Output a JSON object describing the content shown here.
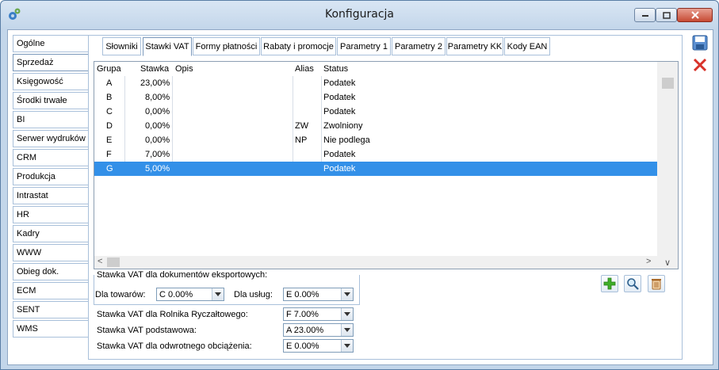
{
  "window": {
    "title": "Konfiguracja"
  },
  "nav": {
    "items": [
      {
        "label": "Ogólne"
      },
      {
        "label": "Sprzedaż"
      },
      {
        "label": "Księgowość"
      },
      {
        "label": "Środki trwałe"
      },
      {
        "label": "BI"
      },
      {
        "label": "Serwer wydruków"
      },
      {
        "label": "CRM"
      },
      {
        "label": "Produkcja"
      },
      {
        "label": "Intrastat"
      },
      {
        "label": "HR"
      },
      {
        "label": "Kadry"
      },
      {
        "label": "WWW"
      },
      {
        "label": "Obieg dok."
      },
      {
        "label": "ECM"
      },
      {
        "label": "SENT"
      },
      {
        "label": "WMS"
      }
    ],
    "active": "Sprzedaż"
  },
  "tabs": [
    {
      "label": "Słowniki"
    },
    {
      "label": "Stawki VAT"
    },
    {
      "label": "Formy płatności"
    },
    {
      "label": "Rabaty i promocje"
    },
    {
      "label": "Parametry 1"
    },
    {
      "label": "Parametry 2"
    },
    {
      "label": "Parametry KK"
    },
    {
      "label": "Kody EAN"
    }
  ],
  "active_tab": "Stawki VAT",
  "grid": {
    "columns": [
      "Grupa",
      "Stawka",
      "Opis",
      "Alias",
      "Status"
    ],
    "rows": [
      {
        "grupa": "A",
        "stawka": "23,00%",
        "opis": "",
        "alias": "",
        "status": "Podatek"
      },
      {
        "grupa": "B",
        "stawka": "8,00%",
        "opis": "",
        "alias": "",
        "status": "Podatek"
      },
      {
        "grupa": "C",
        "stawka": "0,00%",
        "opis": "",
        "alias": "",
        "status": "Podatek"
      },
      {
        "grupa": "D",
        "stawka": "0,00%",
        "opis": "",
        "alias": "ZW",
        "status": "Zwolniony"
      },
      {
        "grupa": "E",
        "stawka": "0,00%",
        "opis": "",
        "alias": "NP",
        "status": "Nie podlega"
      },
      {
        "grupa": "F",
        "stawka": "7,00%",
        "opis": "",
        "alias": "",
        "status": "Podatek"
      },
      {
        "grupa": "G",
        "stawka": "5,00%",
        "opis": "",
        "alias": "",
        "status": "Podatek"
      }
    ],
    "selected_row": 6
  },
  "export_group": {
    "title": "Stawka VAT dla dokumentów eksportowych:",
    "goods_label": "Dla towarów:",
    "goods_value": "C 0.00%",
    "services_label": "Dla usług:",
    "services_value": "E 0.00%"
  },
  "settings": {
    "farmer_label": "Stawka VAT dla Rolnika Ryczałtowego:",
    "farmer_value": "F 7.00%",
    "basic_label": "Stawka VAT podstawowa:",
    "basic_value": "A 23.00%",
    "reverse_label": "Stawka VAT dla odwrotnego obciążenia:",
    "reverse_value": "E 0.00%"
  },
  "icons": {
    "add": "plus-icon",
    "view": "magnifier-icon",
    "delete": "trash-icon",
    "save": "save-icon",
    "cancel": "cancel-icon"
  },
  "colors": {
    "selection": "#3390e8",
    "add_green": "#3fae2a",
    "cancel_red": "#d8322a"
  }
}
